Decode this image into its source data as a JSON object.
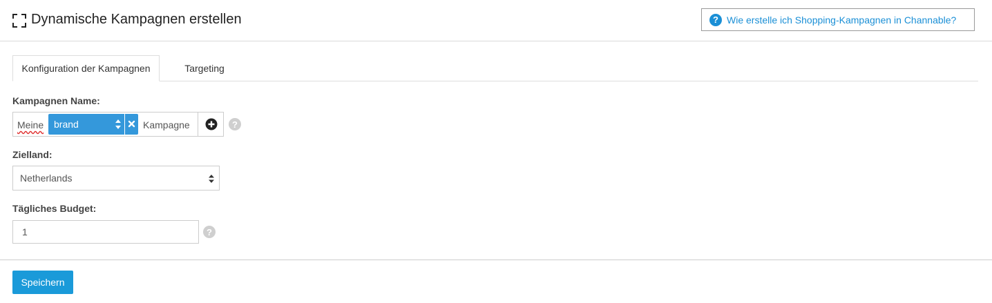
{
  "header": {
    "title": "Dynamische Kampagnen erstellen",
    "help_link": "Wie erstelle ich Shopping-Kampagnen in Channable?"
  },
  "tabs": [
    {
      "label": "Konfiguration der Kampagnen",
      "active": true
    },
    {
      "label": "Targeting",
      "active": false
    }
  ],
  "campaign_name": {
    "label": "Kampagnen Name:",
    "prefix": "Meine",
    "token": "brand",
    "suffix": "Kampagne"
  },
  "target_country": {
    "label": "Zielland:",
    "selected": "Netherlands"
  },
  "daily_budget": {
    "label": "Tägliches Budget:",
    "value": "1"
  },
  "footer": {
    "save_label": "Speichern"
  },
  "colors": {
    "accent": "#1a9ad9",
    "chip": "#3498db",
    "help_link": "#1a8fd6"
  },
  "icons": {
    "fullscreen": "expand-icon",
    "help": "question-circle-icon",
    "sort": "sort-arrows-icon",
    "remove": "close-icon",
    "add": "plus-circle-icon"
  }
}
